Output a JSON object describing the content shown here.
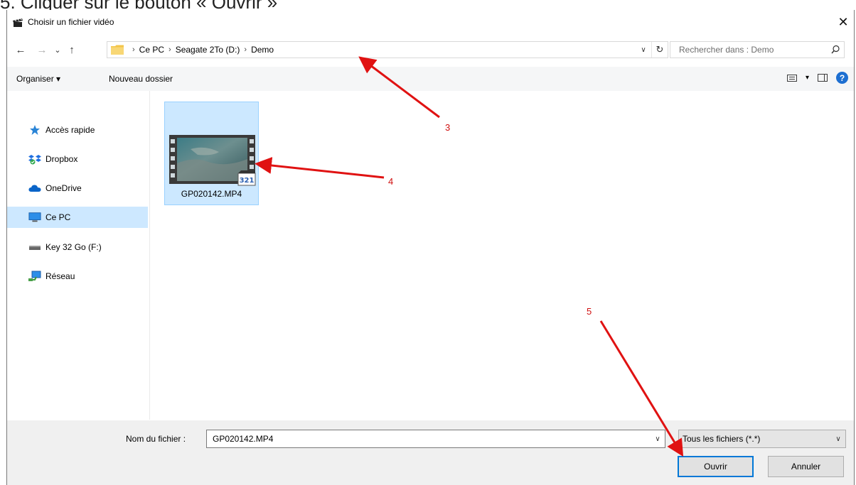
{
  "caption": "5. Cliquer sur le bouton « Ouvrir »",
  "window": {
    "title": "Choisir un fichier vidéo",
    "close_glyph": "✕"
  },
  "nav": {
    "back_glyph": "←",
    "forward_glyph": "→",
    "recent_glyph": "⌄",
    "up_glyph": "↑",
    "breadcrumb": [
      "Ce PC",
      "Seagate 2To (D:)",
      "Demo"
    ],
    "crumb_sep": "›",
    "refresh_glyph": "↻",
    "dropdown_glyph": "∨",
    "search_placeholder": "Rechercher dans : Demo",
    "search_glyph": "⚲"
  },
  "toolbar": {
    "organiser_label": "Organiser ▾",
    "new_folder_label": "Nouveau dossier",
    "view_drop_glyph": "▾",
    "help_glyph": "?"
  },
  "sidebar": {
    "items": [
      {
        "label": "Accès rapide",
        "icon": "star-icon"
      },
      {
        "label": "Dropbox",
        "icon": "dropbox-icon"
      },
      {
        "label": "OneDrive",
        "icon": "cloud-icon"
      },
      {
        "label": "Ce PC",
        "icon": "computer-icon",
        "selected": true
      },
      {
        "label": "Key 32 Go (F:)",
        "icon": "drive-icon"
      },
      {
        "label": "Réseau",
        "icon": "network-icon"
      }
    ]
  },
  "files": [
    {
      "name": "GP020142.MP4",
      "selected": true,
      "badge": "321"
    }
  ],
  "footer": {
    "filename_label": "Nom du fichier :",
    "filename_value": "GP020142.MP4",
    "filetype_value": "Tous les fichiers (*.*)",
    "open_label": "Ouvrir",
    "cancel_label": "Annuler",
    "dropdown_glyph": "∨"
  },
  "annotations": {
    "color": "#d01010",
    "labels": [
      "3",
      "4",
      "5"
    ]
  }
}
